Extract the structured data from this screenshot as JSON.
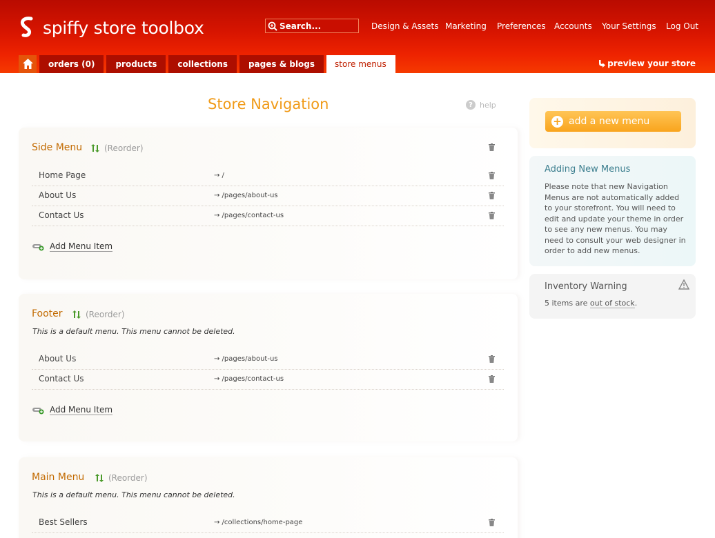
{
  "header": {
    "logo_text": "spiffy store toolbox",
    "search_placeholder": "Search...",
    "nav": [
      "Design & Assets",
      "Marketing",
      "Preferences",
      "Accounts",
      "Your Settings",
      "Log Out"
    ],
    "tabs": [
      "orders (0)",
      "products",
      "collections",
      "pages & blogs",
      "store menus"
    ],
    "active_tab": "store menus",
    "preview_label": "preview your store",
    "icons": [
      "logo-icon",
      "search-icon",
      "home-icon",
      "preview-arrow-icon"
    ]
  },
  "main": {
    "title": "Store Navigation",
    "help_label": "help",
    "reorder_label": "(Reorder)",
    "add_item_label": "Add Menu Item",
    "default_note": "This is a default menu. This menu cannot be deleted.",
    "menus": [
      {
        "name": "Side Menu",
        "items": [
          {
            "label": "Home Page",
            "link": "→ /"
          },
          {
            "label": "About Us",
            "link": "→ /pages/about-us"
          },
          {
            "label": "Contact Us",
            "link": "→ /pages/contact-us"
          }
        ]
      },
      {
        "name": "Footer",
        "items": [
          {
            "label": "About Us",
            "link": "→ /pages/about-us"
          },
          {
            "label": "Contact Us",
            "link": "→ /pages/contact-us"
          }
        ]
      },
      {
        "name": "Main Menu",
        "items": [
          {
            "label": "Best Sellers",
            "link": "→ /collections/home-page"
          }
        ]
      }
    ]
  },
  "sidebar": {
    "add_button": "add a new menu",
    "info_title": "Adding New Menus",
    "info_text": "Please note that new Navigation Menus are not automatically added to your storefront. You will need to edit and update your theme in order to see any new menus. You may need to consult your web designer in order to add new menus.",
    "inventory_title": "Inventory Warning",
    "inventory_prefix": "5 items are ",
    "inventory_link": "out of stock",
    "inventory_suffix": "."
  },
  "colors": {
    "brand_red": "#d81500",
    "accent_orange": "#f09a17",
    "menu_title": "#c26a00",
    "info_title": "#3d7f8f"
  }
}
